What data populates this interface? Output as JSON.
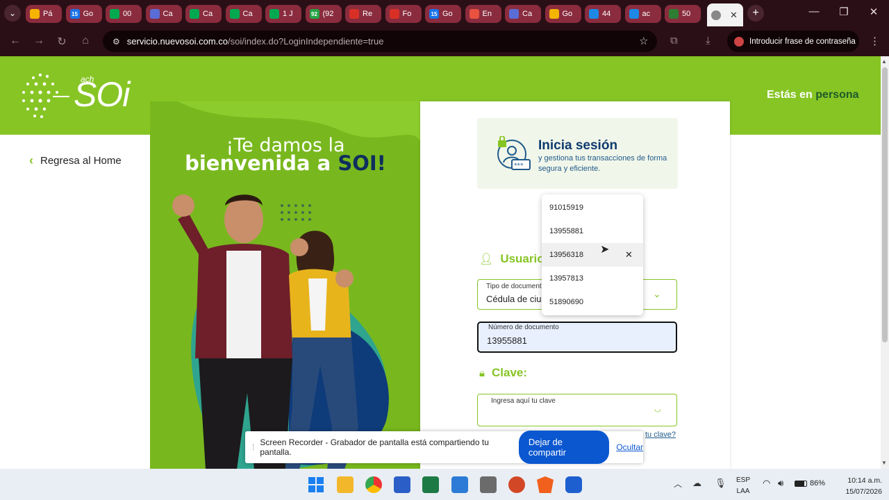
{
  "browser": {
    "tabs": [
      {
        "label": "Pá",
        "fav": "drive-icon",
        "color": "#f6b400",
        "bg": "#8a2c3e"
      },
      {
        "label": "Go",
        "fav": "calendar-icon",
        "color": "#1a73e8",
        "bg": "#8a2c3e"
      },
      {
        "label": "00",
        "fav": "meet-icon",
        "color": "#00a94f",
        "bg": "#8a2c3e"
      },
      {
        "label": "Ca",
        "fav": "card-icon",
        "color": "#5a6dd6",
        "bg": "#8a2c3e"
      },
      {
        "label": "Ca",
        "fav": "meet-icon",
        "color": "#00a94f",
        "bg": "#8a2c3e"
      },
      {
        "label": "Ca",
        "fav": "meet-icon",
        "color": "#00a94f",
        "bg": "#8a2c3e"
      },
      {
        "label": "1 J",
        "fav": "meet-icon",
        "color": "#00a94f",
        "bg": "#8a2c3e"
      },
      {
        "label": "(92",
        "fav": "whatsapp-icon",
        "color": "#25a244",
        "bg": "#8a2c3e"
      },
      {
        "label": "Re",
        "fav": "gmail-icon",
        "color": "#d93025",
        "bg": "#8a2c3e"
      },
      {
        "label": "Fo",
        "fav": "gmail-icon",
        "color": "#d93025",
        "bg": "#8a2c3e"
      },
      {
        "label": "Go",
        "fav": "calendar-icon",
        "color": "#1a73e8",
        "bg": "#8a2c3e"
      },
      {
        "label": "En",
        "fav": "box-icon",
        "color": "#e8523f",
        "bg": "#8a2c3e"
      },
      {
        "label": "Ca",
        "fav": "card-icon",
        "color": "#5a6dd6",
        "bg": "#8a2c3e"
      },
      {
        "label": "Go",
        "fav": "slides-icon",
        "color": "#f4b400",
        "bg": "#8a2c3e"
      },
      {
        "label": "44",
        "fav": "grid-icon",
        "color": "#1e88e5",
        "bg": "#8a2c3e"
      },
      {
        "label": "ac",
        "fav": "grid-icon",
        "color": "#1e88e5",
        "bg": "#8a2c3e"
      },
      {
        "label": "50",
        "fav": "globe-icon",
        "color": "#2e7d32",
        "bg": "#8a2c3e"
      }
    ],
    "fav_texts": {
      "calendar": "15",
      "whatsapp": "92"
    },
    "url_host": "servicio.nuevosoi.com.co",
    "url_path": "/soi/index.do?LoginIndependiente=true",
    "password_prompt": "Introducir frase de contraseña"
  },
  "page": {
    "logo_small": "ach",
    "logo": "SOi",
    "persona_prefix": "Estás en ",
    "persona_word": "persona",
    "back_link": "Regresa al Home",
    "welcome_line1": "¡Te damos la",
    "welcome_line2_a": "bienvenida a ",
    "welcome_line2_b": "SOI!",
    "login_title": "Inicia sesión",
    "login_subtitle": "y gestiona tus transacciones de forma segura y eficiente.",
    "user_section": "Usuario",
    "doc_type_label": "Tipo de documento",
    "doc_type_value": "Cédula de ciudadanía",
    "doc_number_label": "Número de documento",
    "doc_number_value": "13955881",
    "password_section": "Clave:",
    "password_placeholder": "Ingresa aquí tu clave",
    "forgot_link_tail": "tu clave?"
  },
  "autocomplete": {
    "items": [
      "91015919",
      "13955881",
      "13956318",
      "13957813",
      "51890690"
    ],
    "hovered": 2
  },
  "sharebar": {
    "message": "Screen Recorder - Grabador de pantalla está compartiendo tu pantalla.",
    "stop": "Dejar de compartir",
    "hide": "Ocultar"
  },
  "taskbar": {
    "lang1": "ESP",
    "lang2": "LAA",
    "battery": "86%",
    "time": "10:14 a.m.",
    "date": "15/07/2026"
  }
}
